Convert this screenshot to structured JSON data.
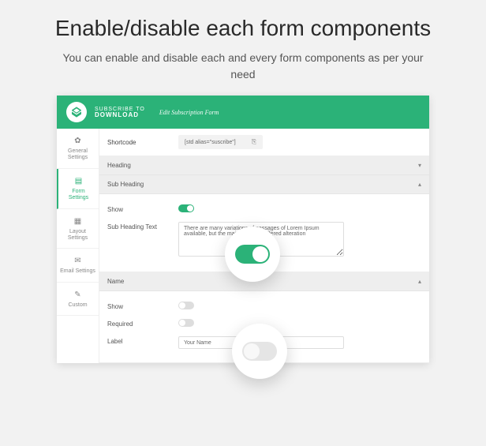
{
  "hero": {
    "title": "Enable/disable each form components",
    "subtitle": "You can enable and disable each and every form components as per your need"
  },
  "header": {
    "logo_top": "SUBSCRIBE TO",
    "logo_bottom": "DOWNLOAD",
    "breadcrumb": "Edit Subscription Form"
  },
  "sidebar": {
    "items": [
      {
        "icon": "gear-icon",
        "glyph": "✿",
        "label": "General Settings"
      },
      {
        "icon": "form-icon",
        "glyph": "▤",
        "label": "Form Settings"
      },
      {
        "icon": "layout-icon",
        "glyph": "▦",
        "label": "Layout Settings"
      },
      {
        "icon": "email-icon",
        "glyph": "✉",
        "label": "Email Settings"
      },
      {
        "icon": "custom-icon",
        "glyph": "✎",
        "label": "Custom"
      }
    ],
    "active_index": 1
  },
  "shortcode": {
    "label": "Shortcode",
    "value": "[std alias=\"suscribe\"]"
  },
  "sections": {
    "heading": {
      "title": "Heading",
      "expanded": false
    },
    "sub_heading": {
      "title": "Sub Heading",
      "expanded": true,
      "show_label": "Show",
      "show_on": true,
      "text_label": "Sub Heading Text",
      "text_value": "There are many variations of passages of Lorem Ipsum available, but the majority have suffered alteration"
    },
    "name": {
      "title": "Name",
      "expanded": true,
      "show_label": "Show",
      "show_on": false,
      "required_label": "Required",
      "required_on": false,
      "label_label": "Label",
      "label_value": "Your Name"
    }
  }
}
